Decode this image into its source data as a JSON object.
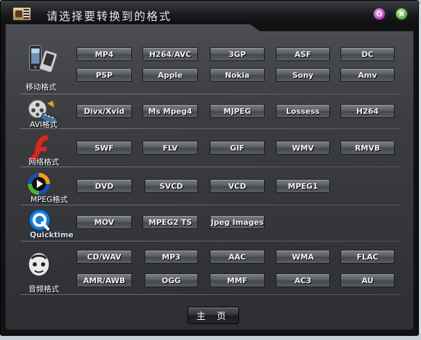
{
  "window": {
    "title": "请选择要转换到的格式",
    "help_icon": "help-icon",
    "close_icon": "close-icon"
  },
  "categories": [
    {
      "label": "移动格式",
      "icon": "mobile-phone-icon",
      "formats": [
        "MP4",
        "H264/AVC",
        "3GP",
        "ASF",
        "DC",
        "PSP",
        "Apple",
        "Nokia",
        "Sony",
        "Amv"
      ]
    },
    {
      "label": "AVI格式",
      "icon": "film-reel-icon",
      "formats": [
        "Divx/Xvid",
        "Ms Mpeg4",
        "MJPEG",
        "Lossess",
        "H264"
      ]
    },
    {
      "label": "网络格式",
      "icon": "flash-icon",
      "formats": [
        "SWF",
        "FLV",
        "GIF",
        "WMV",
        "RMVB"
      ]
    },
    {
      "label": "MPEG格式",
      "icon": "media-player-icon",
      "formats": [
        "DVD",
        "SVCD",
        "VCD",
        "MPEG1"
      ]
    },
    {
      "label": "Quicktime",
      "icon": "quicktime-icon",
      "formats": [
        "MOV",
        "MPEG2 TS",
        "Jpeg Images"
      ]
    },
    {
      "label": "音频格式",
      "icon": "audio-icon",
      "formats": [
        "CD/WAV",
        "MP3",
        "AAC",
        "WMA",
        "FLAC",
        "AMR/AWB",
        "OGG",
        "MMF",
        "AC3",
        "AU"
      ]
    }
  ],
  "footer": {
    "home_label": "主 页"
  }
}
